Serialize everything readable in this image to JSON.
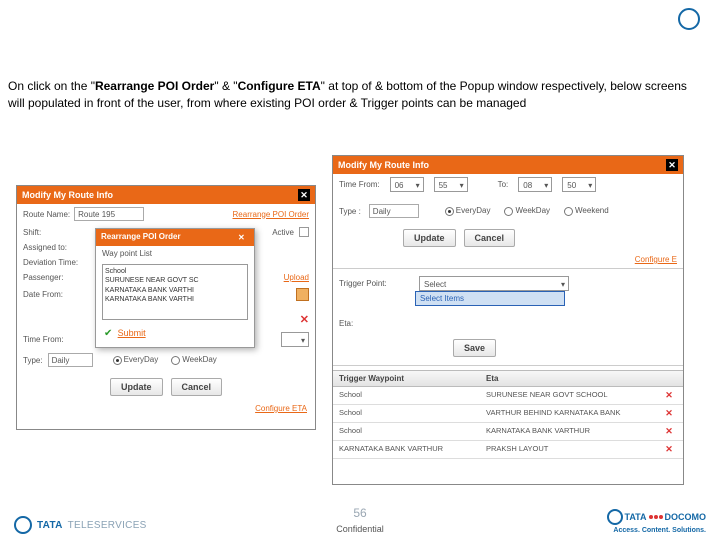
{
  "desc_before1": "On click on the \"",
  "bold1": "Rearrange POI Order",
  "desc_mid1": "\" & \"",
  "bold2": "Configure ETA",
  "desc_after": "\" at top of & bottom of the Popup window respectively, below screens will populated in front of the user, from where existing POI order & Trigger points can be managed",
  "left": {
    "title": "Modify My Route Info",
    "rname_lbl": "Route Name:",
    "rname_val": "Route 195",
    "rearrange": "Rearrange POI Order",
    "shift_lbl": "Shift:",
    "active": "Active",
    "assign_lbl": "Assigned to:",
    "dev_lbl": "Deviation Time:",
    "pas_lbl": "Passenger:",
    "upload": "Upload",
    "date_lbl": "Date From:",
    "time_lbl": "Time From:",
    "type_lbl": "Type:",
    "type_val": "Daily",
    "everyday": "EveryDay",
    "weekday": "WeekDay",
    "update": "Update",
    "cancel": "Cancel",
    "config": "Configure ETA",
    "sub_title": "Rearrange POI Order",
    "sub_hdr": "Way point List",
    "items": "School\nSURUNESE NEAR GOVT SC\nKARNATAKA BANK VARTHI\nKARNATAKA BANK VARTHI",
    "submit": "Submit"
  },
  "right": {
    "title": "Modify My Route Info",
    "tfrom": "Time From:",
    "h1": "06",
    "m1": "55",
    "to": "To:",
    "h2": "08",
    "m2": "50",
    "type": "Type :",
    "type_val": "Daily",
    "everyday": "EveryDay",
    "weekday": "WeekDay",
    "weekend": "Weekend",
    "update": "Update",
    "cancel": "Cancel",
    "config": "Configure E",
    "tp": "Trigger Point:",
    "tp_val": "Select",
    "drop_item": "Select Items",
    "eta": "Eta:",
    "save": "Save",
    "col1": "Trigger Waypoint",
    "col2": "Eta",
    "rows": [
      {
        "a": "School",
        "b": "SURUNESE NEAR GOVT SCHOOL"
      },
      {
        "a": "School",
        "b": "VARTHUR BEHIND KARNATAKA BANK"
      },
      {
        "a": "School",
        "b": "KARNATAKA BANK VARTHUR"
      },
      {
        "a": "KARNATAKA BANK VARTHUR",
        "b": "PRAKSH LAYOUT"
      }
    ]
  },
  "page": "56",
  "conf": "Confidential",
  "tele": "TELESERVICES",
  "docomo": "DOCOMO",
  "tag": "Access. Content. Solutions."
}
